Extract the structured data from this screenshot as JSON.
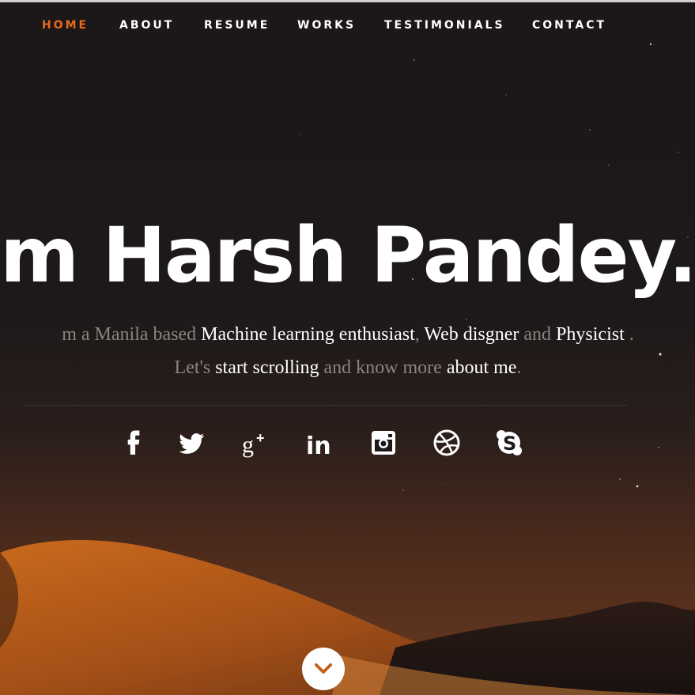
{
  "nav": {
    "items": [
      {
        "label": "HOME",
        "active": true
      },
      {
        "label": "ABOUT",
        "active": false
      },
      {
        "label": "RESUME",
        "active": false
      },
      {
        "label": "WORKS",
        "active": false
      },
      {
        "label": "TESTIMONIALS",
        "active": false
      },
      {
        "label": "CONTACT",
        "active": false
      }
    ]
  },
  "hero": {
    "headline": "m Harsh Pandey.",
    "intro_line1": {
      "lead": "m a Manila based ",
      "h1": "Machine learning enthusiast",
      "sep1": ", ",
      "h2": "Web disgner",
      "sep2": " and ",
      "h3": "Physicist",
      "end": " ."
    },
    "intro_line2": {
      "lead": "Let's ",
      "h1": "start scrolling",
      "mid": " and know more ",
      "h2": "about me",
      "end": "."
    }
  },
  "social": [
    "facebook-icon",
    "twitter-icon",
    "google-plus-icon",
    "linkedin-icon",
    "instagram-icon",
    "dribbble-icon",
    "skype-icon"
  ],
  "colors": {
    "accent": "#e86a1c",
    "text": "#ffffff",
    "muted": "#8a8582",
    "background": "#1b1718"
  }
}
